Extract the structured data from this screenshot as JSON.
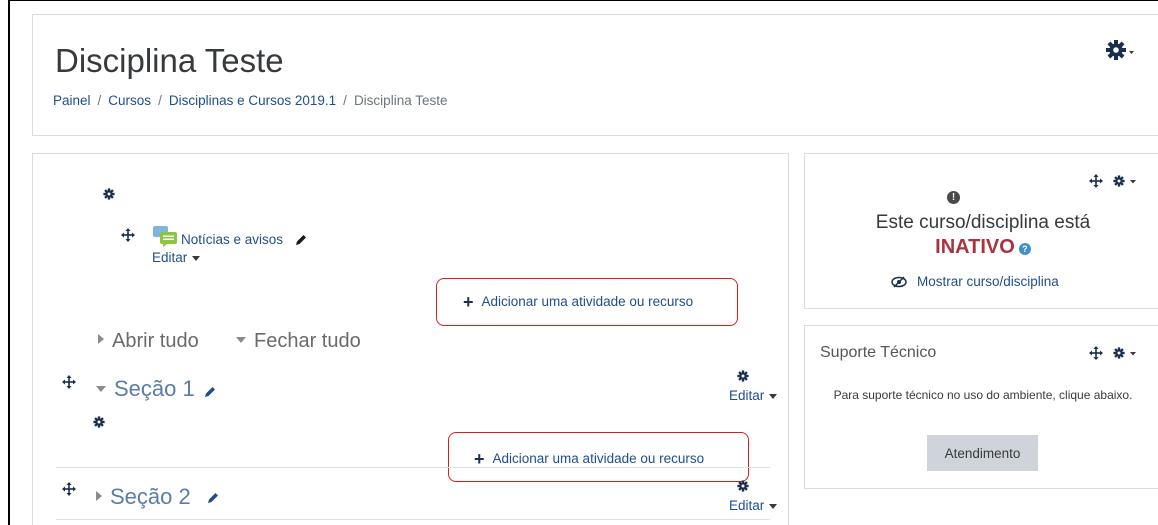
{
  "header": {
    "title": "Disciplina Teste",
    "breadcrumb": {
      "items": [
        "Painel",
        "Cursos",
        "Disciplinas e Cursos 2019.1",
        "Disciplina Teste"
      ],
      "separator": "/"
    }
  },
  "course": {
    "news_forum": "Notícias e avisos",
    "edit_label": "Editar",
    "add_activity_label": "Adicionar uma atividade ou recurso",
    "expand_all": "Abrir tudo",
    "collapse_all": "Fechar tudo",
    "sections": [
      {
        "name": "Seção 1",
        "expanded": true
      },
      {
        "name": "Seção 2",
        "expanded": false
      }
    ]
  },
  "blocks": {
    "status": {
      "line1": "Este curso/disciplina está",
      "state": "INATIVO",
      "state_color": "#a8343e",
      "show_link": "Mostrar curso/disciplina"
    },
    "support": {
      "title": "Suporte Técnico",
      "text": "Para suporte técnico no uso do ambiente, clique abaixo.",
      "button": "Atendimento"
    }
  },
  "icons": [
    "gear-icon",
    "move-icon",
    "pencil-icon",
    "forum-icon",
    "eye-slash-icon",
    "help-icon",
    "warning-icon",
    "plus-icon"
  ],
  "colors": {
    "link": "#1f4e8c",
    "highlight_box": "#e01b1b",
    "section_title": "#5a7ca7"
  }
}
